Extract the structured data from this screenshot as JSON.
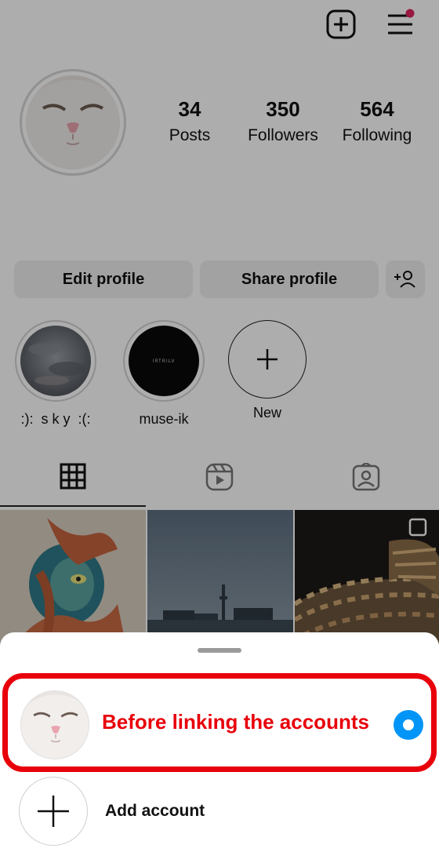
{
  "header": {
    "new_post_icon": "plus-square-icon",
    "menu_icon": "hamburger-menu-icon",
    "notification_dot_color": "#e0245e"
  },
  "profile": {
    "stats": {
      "posts": {
        "value": "34",
        "label": "Posts"
      },
      "followers": {
        "value": "350",
        "label": "Followers"
      },
      "following": {
        "value": "564",
        "label": "Following"
      }
    }
  },
  "actions": {
    "edit_label": "Edit profile",
    "share_label": "Share profile",
    "discover_icon": "add-person-icon"
  },
  "highlights": [
    {
      "label": ":):  s k y  :(:",
      "cover_text": ""
    },
    {
      "label": "muse-ik",
      "cover_text": "IRTRILV"
    },
    {
      "label": "New"
    }
  ],
  "tabs": [
    {
      "icon": "grid-icon",
      "active": true
    },
    {
      "icon": "reels-icon",
      "active": false
    },
    {
      "icon": "tagged-icon",
      "active": false
    }
  ],
  "account_sheet": {
    "current_account_label": "Before linking the accounts",
    "add_account_label": "Add account",
    "highlight_color": "#e8000b",
    "selected_color": "#0095f6"
  }
}
